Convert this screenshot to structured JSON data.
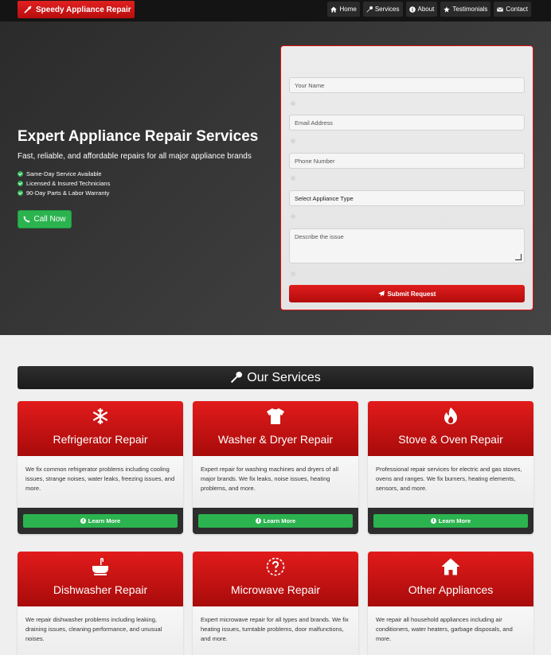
{
  "nav": {
    "brand": "Speedy Appliance Repair",
    "links": [
      {
        "label": "Home",
        "icon": "home-icon"
      },
      {
        "label": "Services",
        "icon": "wrench-icon"
      },
      {
        "label": "About",
        "icon": "info-icon"
      },
      {
        "label": "Testimonials",
        "icon": "star-icon"
      },
      {
        "label": "Contact",
        "icon": "envelope-icon"
      }
    ]
  },
  "hero": {
    "title": "Expert Appliance Repair Services",
    "subtitle": "Fast, reliable, and affordable repairs for all major appliance brands",
    "features": [
      "Same-Day Service Available",
      "Licensed & Insured Technicians",
      "90-Day Parts & Labor Warranty"
    ],
    "call_label": "Call Now"
  },
  "form": {
    "name_placeholder": "Your Name",
    "email_placeholder": "Email Address",
    "phone_placeholder": "Phone Number",
    "appliance_selected": "Select Appliance Type",
    "issue_placeholder": "Describe the issue",
    "submit_label": "Submit Request"
  },
  "services": {
    "heading": "Our Services",
    "learn_more": "Learn More",
    "items": [
      {
        "title": "Refrigerator Repair",
        "icon": "snowflake-icon",
        "desc": "We fix common refrigerator problems including cooling issues, strange noises, water leaks, freezing issues, and more."
      },
      {
        "title": "Washer & Dryer Repair",
        "icon": "shirt-icon",
        "desc": "Expert repair for washing machines and dryers of all major brands. We fix leaks, noise issues, heating problems, and more."
      },
      {
        "title": "Stove & Oven Repair",
        "icon": "flame-icon",
        "desc": "Professional repair services for electric and gas stoves, ovens and ranges. We fix burners, heating elements, sensors, and more."
      },
      {
        "title": "Dishwasher Repair",
        "icon": "sink-icon",
        "desc": "We repair dishwasher problems including leaking, draining issues, cleaning performance, and unusual noises."
      },
      {
        "title": "Microwave Repair",
        "icon": "question-circle-icon",
        "desc": "Expert microwave repair for all types and brands. We fix heating issues, turntable problems, door malfunctions, and more."
      },
      {
        "title": "Other Appliances",
        "icon": "house-icon",
        "desc": "We repair all household appliances including air conditioners, water heaters, garbage disposals, and more."
      }
    ]
  }
}
